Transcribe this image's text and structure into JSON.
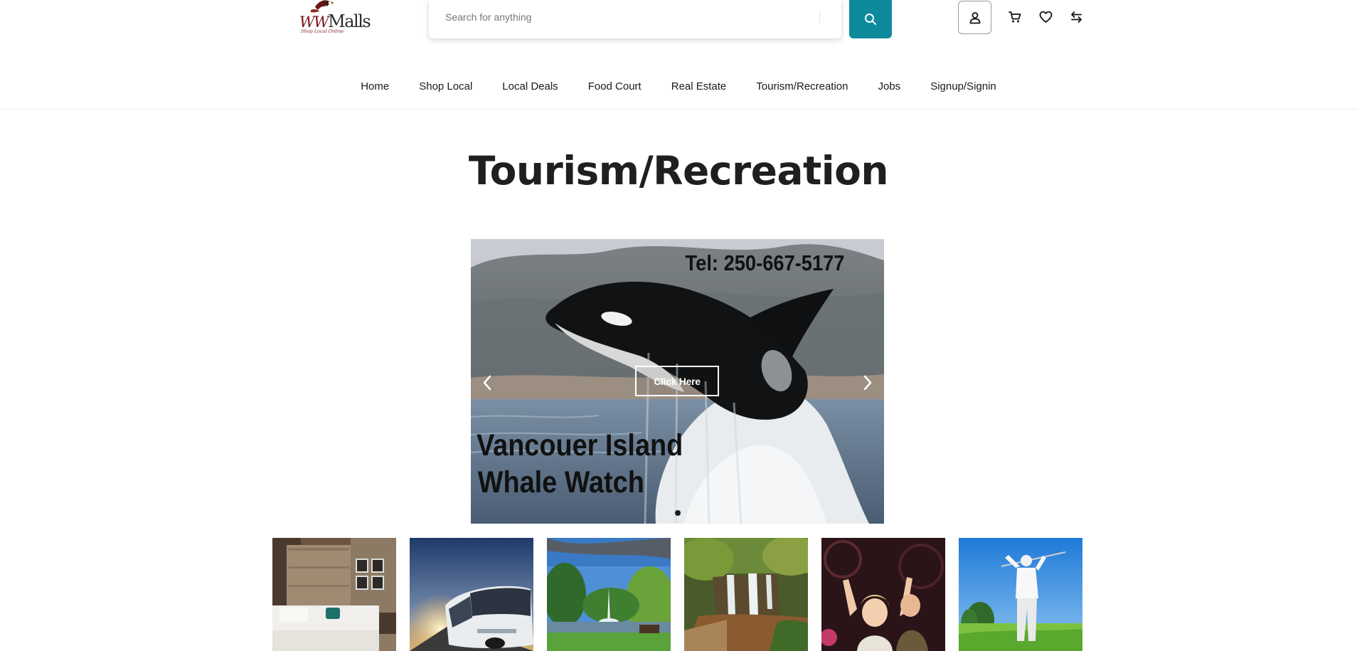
{
  "header": {
    "logo": {
      "brand_prefix": "WW",
      "brand_name": "Malls",
      "tagline": "Shop Local Online",
      "icon": "eagle-logo-icon"
    },
    "search": {
      "placeholder": "Search for anything",
      "value": "",
      "icon": "search-icon"
    },
    "icons": {
      "account": "user-icon",
      "cart": "cart-icon",
      "wishlist": "heart-icon",
      "compare": "compare-arrows-icon"
    },
    "colors": {
      "accent": "#0d8a9c",
      "logo_red": "#7a1216"
    }
  },
  "nav": {
    "items": [
      {
        "label": "Home"
      },
      {
        "label": "Shop Local"
      },
      {
        "label": "Local Deals"
      },
      {
        "label": "Food Court"
      },
      {
        "label": "Real Estate"
      },
      {
        "label": "Tourism/Recreation"
      },
      {
        "label": "Jobs"
      },
      {
        "label": "Signup/Signin"
      }
    ]
  },
  "main": {
    "title": "Tourism/Recreation",
    "carousel": {
      "slide": {
        "phone": "Tel: 250-667-5177",
        "headline_line1": "Vancouer Island",
        "headline_line2": "Whale Watch",
        "cta_label": "Click Here"
      },
      "prev_icon": "chevron-left-icon",
      "next_icon": "chevron-right-icon",
      "active_slide": 1,
      "slide_count": 1
    },
    "thumbnails": [
      {
        "name": "hotel-room-image"
      },
      {
        "name": "tour-bus-image"
      },
      {
        "name": "park-fountain-image"
      },
      {
        "name": "waterfall-image"
      },
      {
        "name": "theatre-performers-image"
      },
      {
        "name": "golfer-image"
      }
    ]
  }
}
